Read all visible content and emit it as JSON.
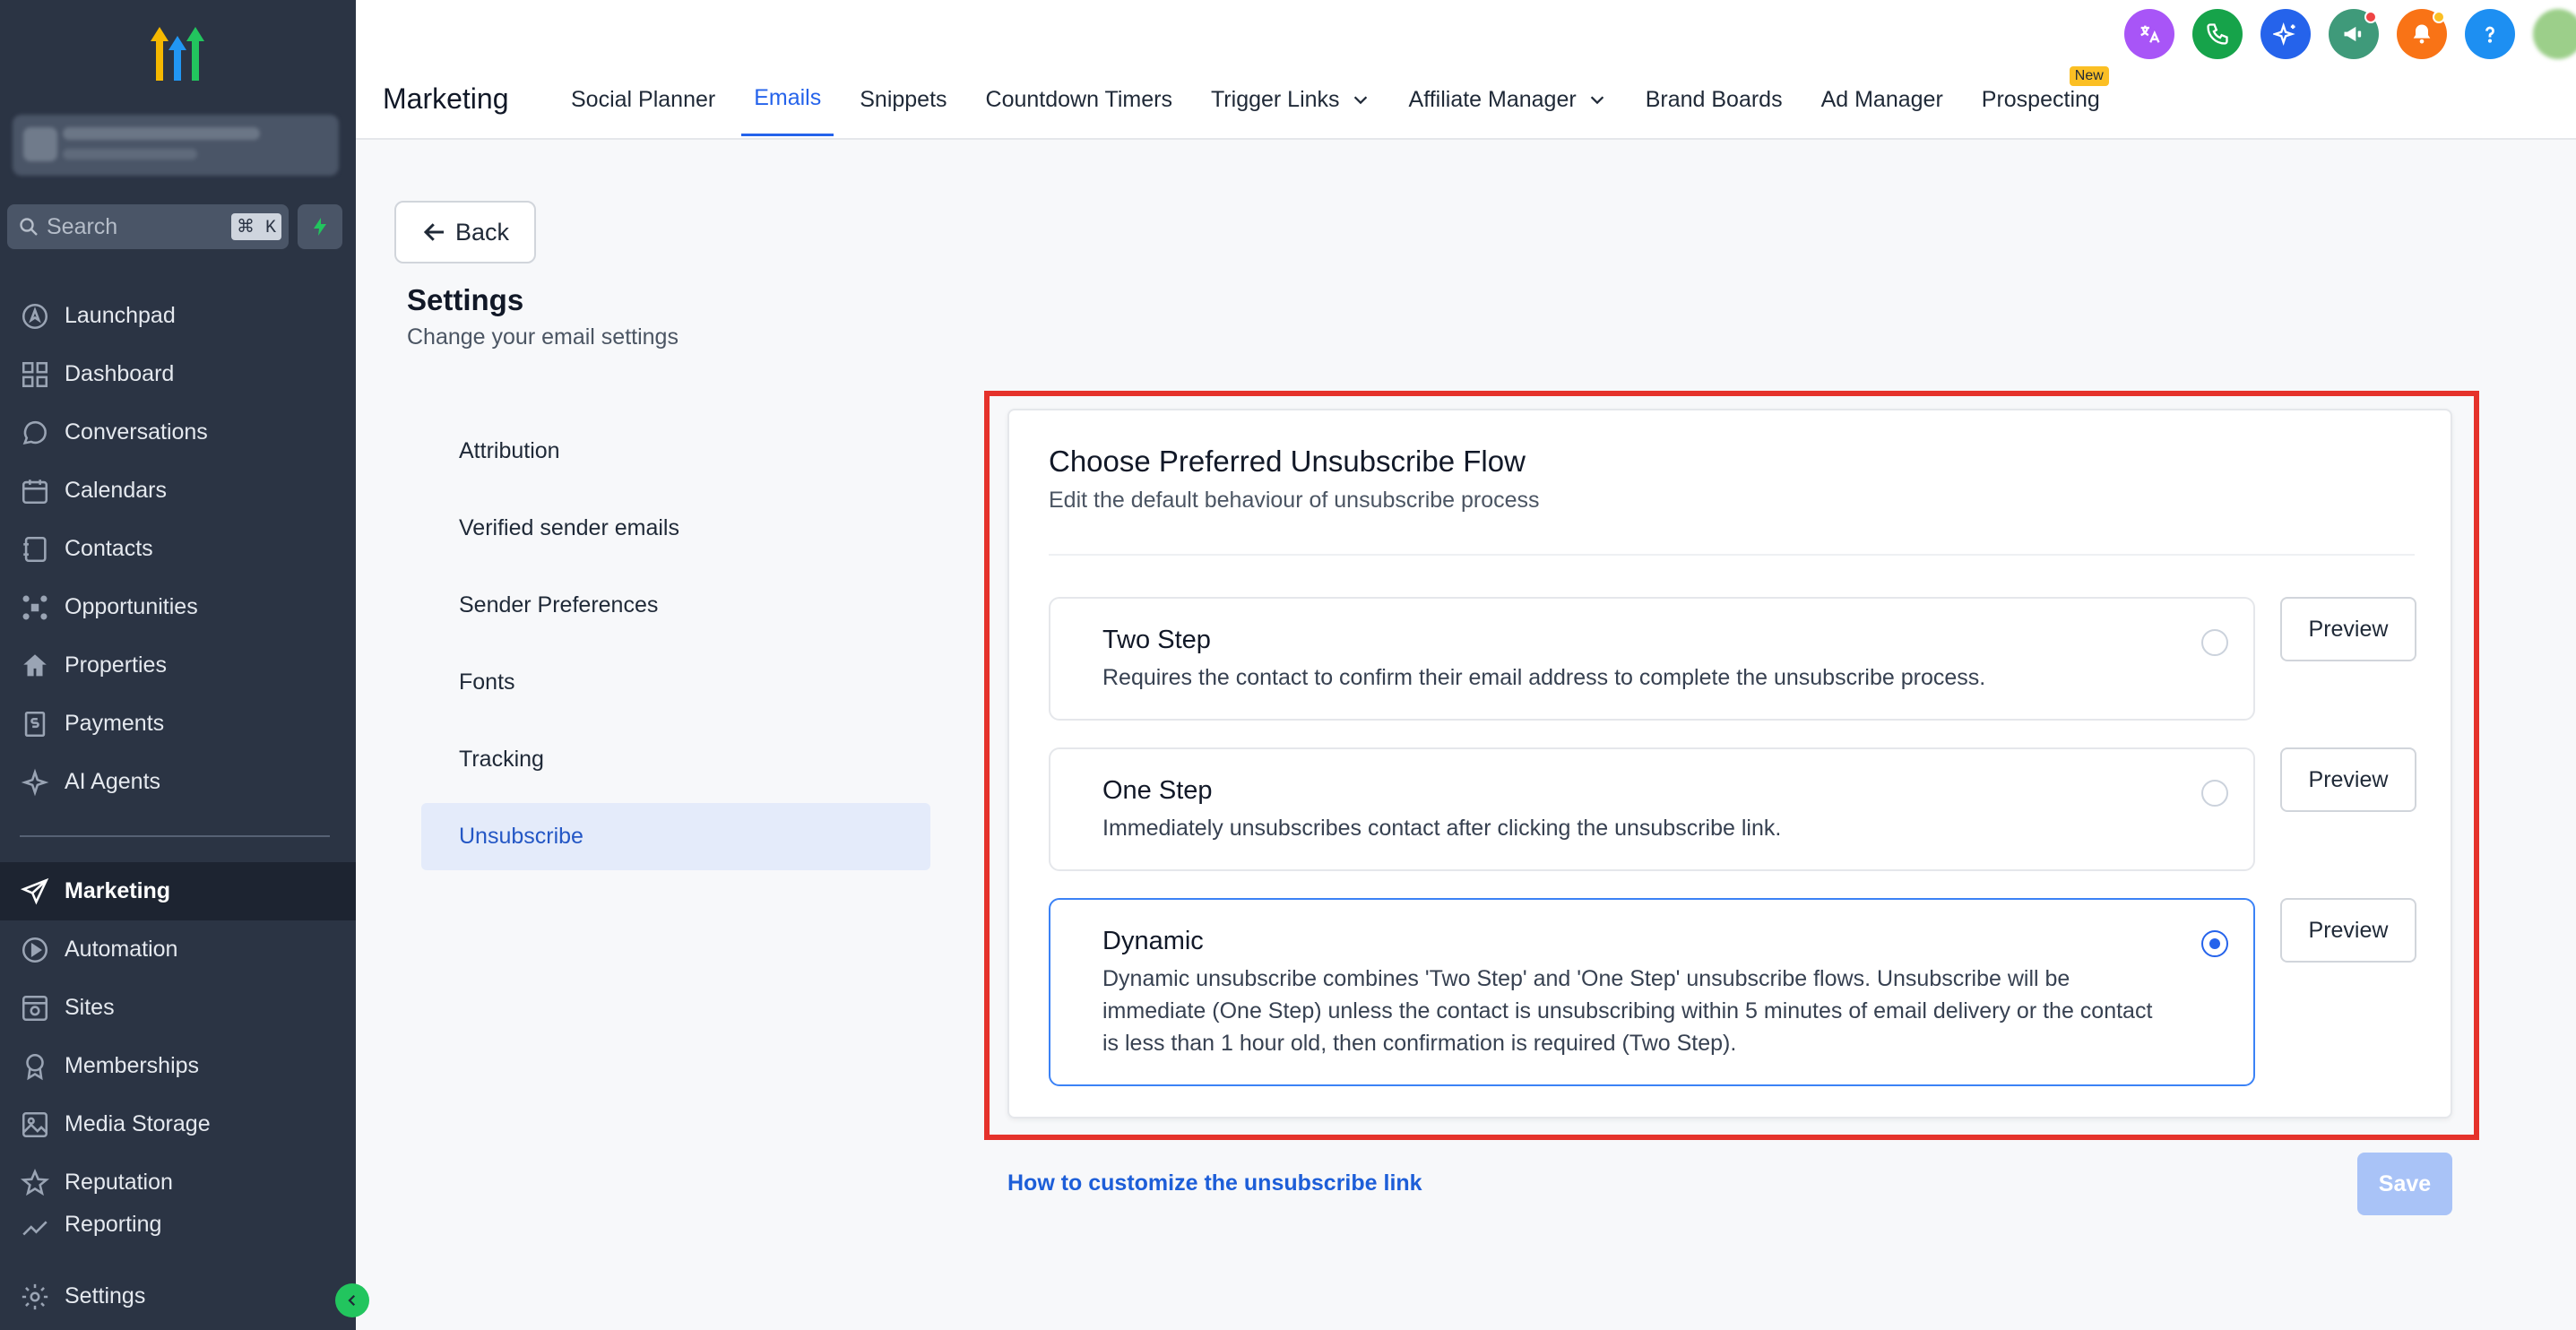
{
  "colors": {
    "sidebar_bg": "#2b3444",
    "accent": "#2563eb",
    "highlight_outline": "#e5322b",
    "save_disabled": "#a9c3f7"
  },
  "sidebar": {
    "search_placeholder": "Search",
    "search_shortcut": "⌘ K",
    "items": [
      {
        "label": "Launchpad",
        "icon": "rocket-icon"
      },
      {
        "label": "Dashboard",
        "icon": "grid-icon"
      },
      {
        "label": "Conversations",
        "icon": "chat-icon"
      },
      {
        "label": "Calendars",
        "icon": "calendar-icon"
      },
      {
        "label": "Contacts",
        "icon": "contacts-icon"
      },
      {
        "label": "Opportunities",
        "icon": "network-icon"
      },
      {
        "label": "Properties",
        "icon": "home-icon"
      },
      {
        "label": "Payments",
        "icon": "payments-icon"
      },
      {
        "label": "AI Agents",
        "icon": "sparkle-icon"
      }
    ],
    "items2": [
      {
        "label": "Marketing",
        "icon": "send-icon",
        "active": true
      },
      {
        "label": "Automation",
        "icon": "automation-icon"
      },
      {
        "label": "Sites",
        "icon": "sites-icon"
      },
      {
        "label": "Memberships",
        "icon": "award-icon"
      },
      {
        "label": "Media Storage",
        "icon": "image-icon"
      },
      {
        "label": "Reputation",
        "icon": "star-icon"
      },
      {
        "label": "Reporting",
        "icon": "chart-icon"
      }
    ],
    "settings_label": "Settings"
  },
  "header": {
    "title": "Marketing",
    "tabs": [
      {
        "label": "Social Planner"
      },
      {
        "label": "Emails",
        "active": true
      },
      {
        "label": "Snippets"
      },
      {
        "label": "Countdown Timers"
      },
      {
        "label": "Trigger Links",
        "dropdown": true
      },
      {
        "label": "Affiliate Manager",
        "dropdown": true
      },
      {
        "label": "Brand Boards"
      },
      {
        "label": "Ad Manager"
      },
      {
        "label": "Prospecting",
        "badge": "New"
      }
    ]
  },
  "page": {
    "back_label": "Back",
    "title": "Settings",
    "subtitle": "Change your email settings",
    "menu": [
      "Attribution",
      "Verified sender emails",
      "Sender Preferences",
      "Fonts",
      "Tracking",
      "Unsubscribe"
    ],
    "menu_active": 5
  },
  "card": {
    "title": "Choose Preferred Unsubscribe Flow",
    "subtitle": "Edit the default behaviour of unsubscribe process",
    "options": [
      {
        "title": "Two Step",
        "desc": "Requires the contact to confirm their email address to complete the unsubscribe process.",
        "selected": false
      },
      {
        "title": "One Step",
        "desc": "Immediately unsubscribes contact after clicking the unsubscribe link.",
        "selected": false
      },
      {
        "title": "Dynamic",
        "desc": "Dynamic unsubscribe combines 'Two Step' and 'One Step' unsubscribe flows. Unsubscribe will be immediate (One Step) unless the contact is unsubscribing within 5 minutes of email delivery or the contact is less than 1 hour old, then confirmation is required (Two Step).",
        "selected": true
      }
    ],
    "preview_label": "Preview"
  },
  "footer": {
    "help_link": "How to customize the unsubscribe link",
    "save_label": "Save"
  }
}
